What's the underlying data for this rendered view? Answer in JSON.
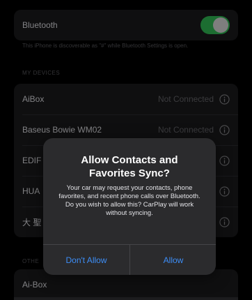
{
  "bluetooth": {
    "label": "Bluetooth",
    "enabled": true,
    "footnote": "This iPhone is discoverable as \"#\" while Bluetooth Settings is open."
  },
  "my_devices": {
    "header": "MY DEVICES",
    "items": [
      {
        "name": "AiBox",
        "status": "Not Connected"
      },
      {
        "name": "Baseus Bowie WM02",
        "status": "Not Connected"
      },
      {
        "name": "EDIF",
        "status": ""
      },
      {
        "name": "HUA",
        "status": ""
      },
      {
        "name": "大 聖",
        "status": ""
      }
    ]
  },
  "other_devices": {
    "header": "OTHE",
    "items": [
      {
        "name": "Ai-Box"
      }
    ]
  },
  "alert": {
    "title": "Allow Contacts and Favorites Sync?",
    "message": "Your car may request your contacts, phone favorites, and recent phone calls over Bluetooth. Do you wish to allow this? CarPlay will work without syncing.",
    "buttons": {
      "dont_allow": "Don't Allow",
      "allow": "Allow"
    }
  },
  "colors": {
    "background": "#000000",
    "cell": "#1c1c1e",
    "toggle_on": "#34c759",
    "alert_bg": "#2b2b2d",
    "action_blue": "#3d8ef7",
    "secondary_text": "#6b6b70"
  },
  "icons": [
    "info-icon"
  ]
}
